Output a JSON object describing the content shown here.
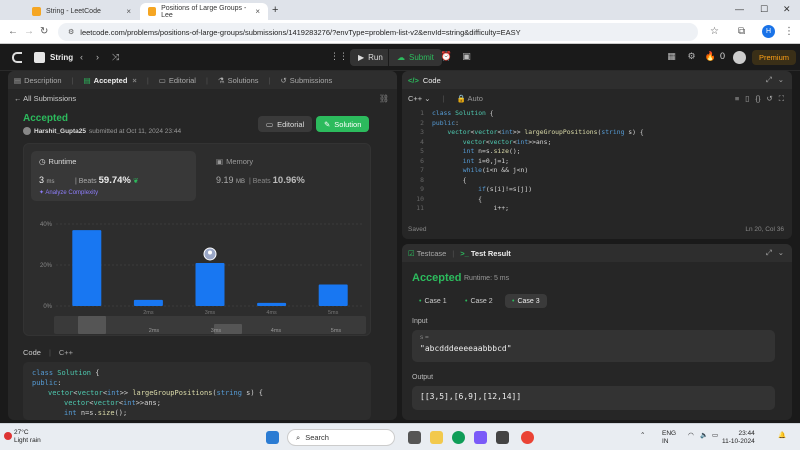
{
  "browser": {
    "tabs": [
      {
        "title": "String - LeetCode"
      },
      {
        "title": "Positions of Large Groups - Lee"
      }
    ],
    "url": "leetcode.com/problems/positions-of-large-groups/submissions/1419283276/?envType=problem-list-v2&envId=string&difficulty=EASY",
    "profile_initial": "H"
  },
  "topbar": {
    "list_title": "String",
    "run_label": "Run",
    "submit_label": "Submit",
    "streak_count": "0",
    "premium_label": "Premium"
  },
  "left": {
    "tabs": [
      "Description",
      "Accepted",
      "Editorial",
      "Solutions",
      "Submissions"
    ],
    "all_submissions": "All Submissions",
    "status": "Accepted",
    "user": "Harshit_Gupta25",
    "submitted_text": "submitted at Oct 11, 2024 23:44",
    "editorial_btn": "Editorial",
    "solution_btn": "Solution",
    "runtime": {
      "label": "Runtime",
      "value": "3",
      "unit": "ms",
      "beats_label": "Beats",
      "beats": "59.74%",
      "analyze": "Analyze Complexity"
    },
    "memory": {
      "label": "Memory",
      "value": "9.19",
      "unit": "MB",
      "beats_label": "Beats",
      "beats": "10.96%"
    },
    "code_label": "Code",
    "code_lang": "C++",
    "code_preview": [
      "class Solution {",
      "public:",
      "    vector<vector<int>> largeGroupPositions(string s) {",
      "        vector<vector<int>>ans;",
      "        int n=s.size();"
    ]
  },
  "chart_data": {
    "type": "bar",
    "categories": [
      "",
      "2ms",
      "3ms",
      "4ms",
      "5ms"
    ],
    "values": [
      37,
      3,
      21,
      1.5,
      10.5
    ],
    "highlight_index": 2,
    "yticks": [
      "40%",
      "20%",
      "0%"
    ],
    "ylim": [
      0,
      40
    ],
    "color": "#1877f2",
    "minimap_labels": [
      "2ms",
      "3ms",
      "4ms",
      "5ms"
    ]
  },
  "code_panel": {
    "title": "Code",
    "language": "C++",
    "mode": "Auto",
    "lines": [
      {
        "n": "1",
        "t": "class Solution {"
      },
      {
        "n": "2",
        "t": "public:"
      },
      {
        "n": "3",
        "t": "    vector<vector<int>> largeGroupPositions(string s) {"
      },
      {
        "n": "4",
        "t": "        vector<vector<int>>ans;"
      },
      {
        "n": "5",
        "t": "        int n=s.size();"
      },
      {
        "n": "6",
        "t": "        int i=0,j=1;"
      },
      {
        "n": "7",
        "t": "        while(i<n && j<n)"
      },
      {
        "n": "8",
        "t": "        {"
      },
      {
        "n": "9",
        "t": "            if(s[i]!=s[j])"
      },
      {
        "n": "10",
        "t": "            {"
      },
      {
        "n": "11",
        "t": "                i++;"
      }
    ],
    "saved": "Saved",
    "position": "Ln 20, Col 36"
  },
  "test_panel": {
    "testcase_tab": "Testcase",
    "result_tab": "Test Result",
    "status": "Accepted",
    "runtime": "Runtime: 5 ms",
    "cases": [
      "Case 1",
      "Case 2",
      "Case 3"
    ],
    "input_label": "Input",
    "input_key": "s =",
    "input_value": "\"abcdddeeeeaabbbcd\"",
    "output_label": "Output",
    "output_value": "[[3,5],[6,9],[12,14]]"
  },
  "taskbar": {
    "temp": "27°C",
    "weather": "Light rain",
    "search_placeholder": "Search",
    "lang": "ENG",
    "region": "IN",
    "time": "23:44",
    "date": "11-10-2024"
  },
  "colors": {
    "accent_green": "#2cbb5d",
    "bar_blue": "#1877f2",
    "premium": "#ffa116"
  }
}
